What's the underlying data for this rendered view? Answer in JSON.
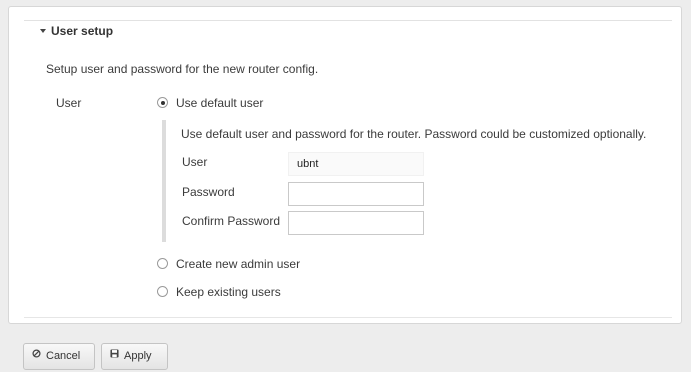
{
  "section": {
    "title": "User setup",
    "description": "Setup user and password for the new router config."
  },
  "user_field": {
    "label": "User",
    "options": [
      {
        "label": "Use default user",
        "selected": true
      },
      {
        "label": "Create new admin user",
        "selected": false
      },
      {
        "label": "Keep existing users",
        "selected": false
      }
    ]
  },
  "default_user": {
    "description": "Use default user and password for the router. Password could be customized optionally.",
    "user_label": "User",
    "user_value": "ubnt",
    "password_label": "Password",
    "password_value": "",
    "confirm_label": "Confirm Password",
    "confirm_value": ""
  },
  "buttons": {
    "cancel": "Cancel",
    "apply": "Apply"
  }
}
